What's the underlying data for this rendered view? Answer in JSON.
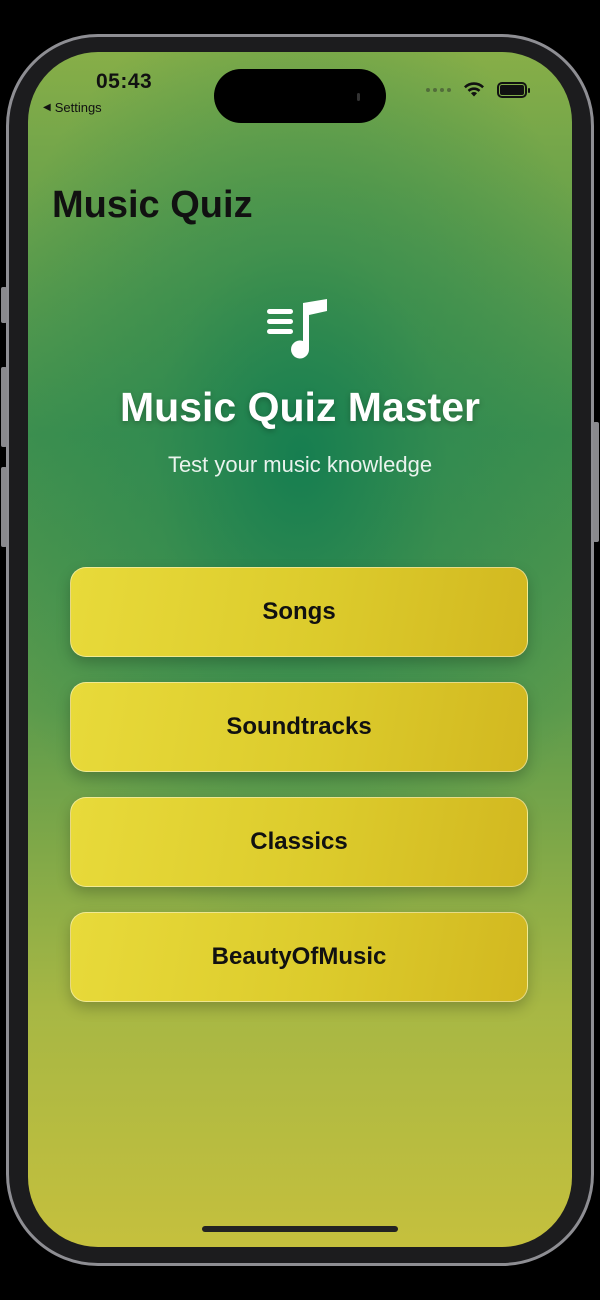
{
  "status_bar": {
    "time": "05:43",
    "back_label": "Settings"
  },
  "nav": {
    "title": "Music Quiz"
  },
  "hero": {
    "icon": "music-note-list-icon",
    "title": "Music Quiz Master",
    "subtitle": "Test your music knowledge"
  },
  "categories": [
    {
      "label": "Songs"
    },
    {
      "label": "Soundtracks"
    },
    {
      "label": "Classics"
    },
    {
      "label": "BeautyOfMusic"
    }
  ],
  "colors": {
    "button_yellow": "#dccb2c",
    "background_green": "#3f904f",
    "background_yellow": "#c5c03d"
  }
}
